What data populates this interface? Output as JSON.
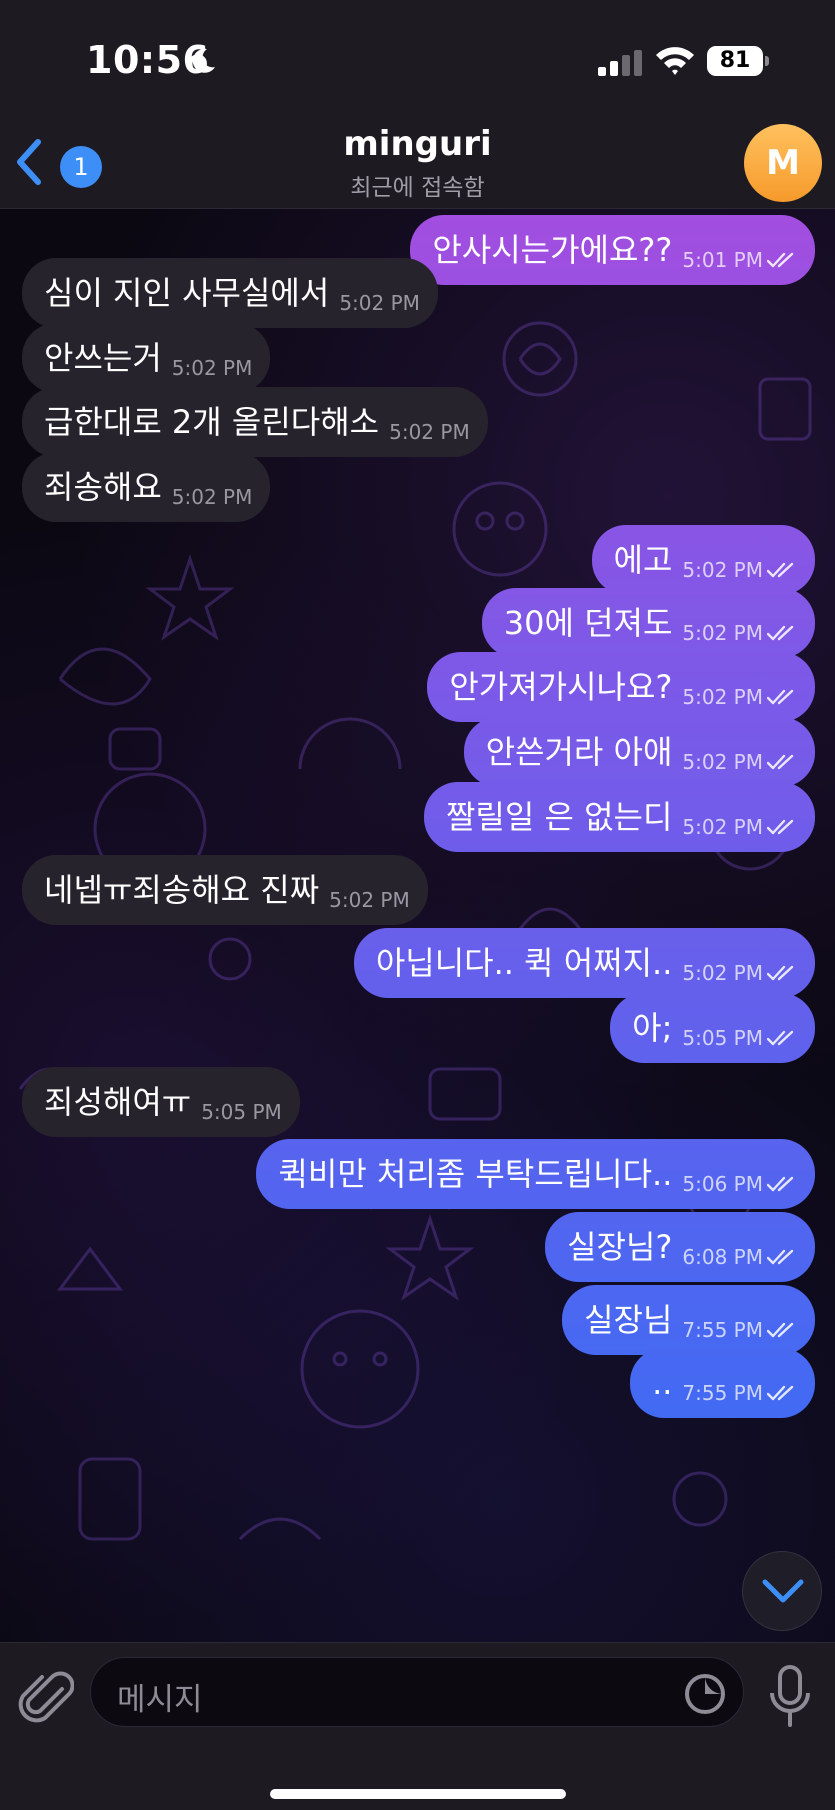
{
  "status_bar": {
    "time": "10:56",
    "battery": "81"
  },
  "header": {
    "back_badge": "1",
    "title": "minguri",
    "subtitle": "최근에 접속함",
    "avatar_letter": "M"
  },
  "messages": [
    {
      "dir": "out",
      "text": "안사시는가에요??",
      "time": "5:01 PM"
    },
    {
      "dir": "in",
      "text": "심이 지인 사무실에서",
      "time": "5:02 PM"
    },
    {
      "dir": "in",
      "text": "안쓰는거",
      "time": "5:02 PM"
    },
    {
      "dir": "in",
      "text": "급한대로 2개 올린다해소",
      "time": "5:02 PM"
    },
    {
      "dir": "in",
      "text": "죄송해요",
      "time": "5:02 PM"
    },
    {
      "dir": "out",
      "text": "에고",
      "time": "5:02 PM"
    },
    {
      "dir": "out",
      "text": "30에 던져도",
      "time": "5:02 PM"
    },
    {
      "dir": "out",
      "text": "안가져가시나요?",
      "time": "5:02 PM"
    },
    {
      "dir": "out",
      "text": "안쓴거라 아애",
      "time": "5:02 PM"
    },
    {
      "dir": "out",
      "text": "짤릴일 은 없는디",
      "time": "5:02 PM"
    },
    {
      "dir": "in",
      "text": "네넵ㅠ죄송해요 진짜",
      "time": "5:02 PM"
    },
    {
      "dir": "out",
      "text": "아닙니다.. 퀵 어쩌지..",
      "time": "5:02 PM"
    },
    {
      "dir": "out",
      "text": "아;",
      "time": "5:05 PM"
    },
    {
      "dir": "in",
      "text": "죄성해여ㅠ",
      "time": "5:05 PM"
    },
    {
      "dir": "out",
      "text": "퀵비만 처리좀 부탁드립니다..",
      "time": "5:06 PM"
    },
    {
      "dir": "out",
      "text": "실장님?",
      "time": "6:08 PM"
    },
    {
      "dir": "out",
      "text": "실장님",
      "time": "7:55 PM"
    },
    {
      "dir": "out",
      "text": "..",
      "time": "7:55 PM"
    }
  ],
  "input": {
    "placeholder": "메시지"
  },
  "colors": {
    "bubble_out_top": "#a24ee0",
    "bubble_out_bottom": "#3b6cf4",
    "bubble_in": "#26232d",
    "accent_blue": "#3e8ef7"
  },
  "icons": [
    "moon-icon",
    "signal-icon",
    "wifi-icon",
    "battery-icon",
    "back-chevron-icon",
    "read-checks-icon",
    "scroll-down-icon",
    "attach-icon",
    "sticker-icon",
    "mic-icon"
  ]
}
